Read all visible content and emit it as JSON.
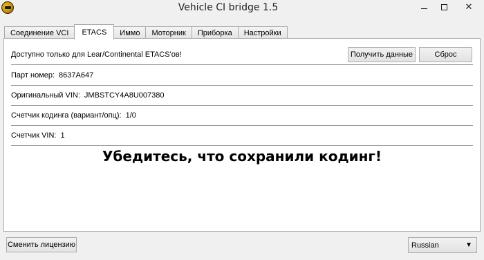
{
  "window": {
    "title": "Vehicle CI bridge  1.5"
  },
  "tabs": [
    {
      "label": "Соединение VCI"
    },
    {
      "label": "ETACS"
    },
    {
      "label": "Иммо"
    },
    {
      "label": "Моторник"
    },
    {
      "label": "Приборка"
    },
    {
      "label": "Настройки"
    }
  ],
  "etacs": {
    "notice": "Доступно только для Lear/Continental ETACS'ов!",
    "get_data_button": "Получить данные",
    "reset_button": "Сброс",
    "part_number_label": "Парт номер:",
    "part_number_value": "8637A647",
    "original_vin_label": "Оригинальный VIN:",
    "original_vin_value": "JMBSTCY4A8U007380",
    "coding_counter_label": "Счетчик кодинга (вариант/опц):",
    "coding_counter_value": "1/0",
    "vin_counter_label": "Счетчик VIN:",
    "vin_counter_value": "1",
    "warning": "Убедитесь, что сохранили кодинг!"
  },
  "footer": {
    "change_license_button": "Сменить лицензию",
    "language_selected": "Russian"
  }
}
